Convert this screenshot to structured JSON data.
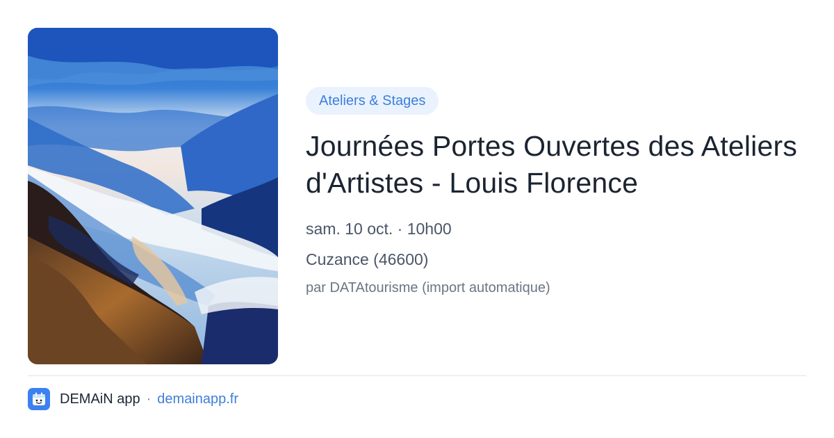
{
  "event": {
    "category": "Ateliers & Stages",
    "title": "Journées Portes Ouvertes des Ateliers d'Artistes - Louis Florence",
    "datetime": "sam. 10 oct. · 10h00",
    "location": "Cuzance (46600)",
    "source": "par DATAtourisme (import automatique)"
  },
  "footer": {
    "app_name": "DEMAiN app",
    "separator": "·",
    "site": "demainapp.fr"
  },
  "colors": {
    "accent": "#3d7fd9",
    "chip_bg": "#e9f2fd",
    "logo_bg": "#3b82f0"
  },
  "icons": {
    "app_logo": "demain-app-logo-icon"
  }
}
